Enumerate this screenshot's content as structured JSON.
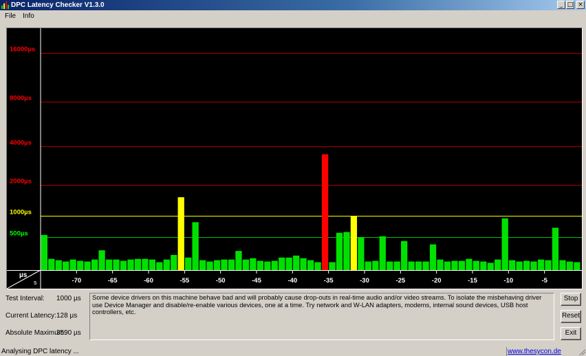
{
  "window": {
    "title": "DPC Latency Checker V1.3.0",
    "buttons": {
      "minimize": "_",
      "maximize": "□",
      "close": "×"
    }
  },
  "menu": {
    "file": "File",
    "info": "Info"
  },
  "chart_data": {
    "type": "bar",
    "ylabel": "µs",
    "xlabel": "s",
    "y_ticks": [
      {
        "label": "16000µs",
        "value": 16000,
        "color": "#ff0000"
      },
      {
        "label": "8000µs",
        "value": 8000,
        "color": "#ff0000"
      },
      {
        "label": "4000µs",
        "value": 4000,
        "color": "#ff0000"
      },
      {
        "label": "2000µs",
        "value": 2000,
        "color": "#ff0000"
      },
      {
        "label": "1000µs",
        "value": 1000,
        "color": "#ffff00"
      },
      {
        "label": "500µs",
        "value": 500,
        "color": "#00ff00"
      }
    ],
    "y_gridline_colors": {
      "red": "#b00000",
      "yellow": "#ffff00",
      "green": "#00c000"
    },
    "x_ticks": [
      -70,
      -65,
      -60,
      -55,
      -50,
      -45,
      -40,
      -35,
      -30,
      -25,
      -20,
      -15,
      -10,
      -5
    ],
    "x_range": [
      -75,
      0
    ],
    "values": [
      550,
      170,
      150,
      130,
      160,
      140,
      130,
      160,
      300,
      160,
      160,
      140,
      160,
      170,
      170,
      160,
      120,
      160,
      230,
      1600,
      190,
      850,
      150,
      130,
      150,
      160,
      160,
      290,
      160,
      180,
      140,
      130,
      140,
      190,
      190,
      220,
      180,
      150,
      120,
      3590,
      120,
      600,
      620,
      1000,
      500,
      130,
      140,
      520,
      130,
      130,
      440,
      130,
      130,
      130,
      390,
      160,
      130,
      140,
      140,
      170,
      140,
      130,
      110,
      160,
      940,
      150,
      130,
      140,
      130,
      160,
      150,
      720,
      150,
      130,
      120
    ],
    "bar_colors": {
      "ok": "#00e000",
      "warn": "#ffff00",
      "bad": "#ff0000"
    }
  },
  "stats": {
    "test_interval_label": "Test Interval:",
    "test_interval_value": "1000 µs",
    "current_latency_label": "Current Latency:",
    "current_latency_value": "128 µs",
    "absolute_maximum_label": "Absolute Maximum:",
    "absolute_maximum_value": "3590 µs"
  },
  "message": "Some device drivers on this machine behave bad and will probably cause drop-outs in real-time audio and/or video streams. To isolate the misbehaving driver use Device Manager and disable/re-enable various devices, one at a time. Try network and W-LAN adapters, modems, internal sound devices, USB host controllers, etc.",
  "buttons": {
    "stop": "Stop",
    "reset": "Reset",
    "exit": "Exit"
  },
  "status": {
    "text": "Analysing DPC latency ...",
    "link": "www.thesycon.de"
  }
}
